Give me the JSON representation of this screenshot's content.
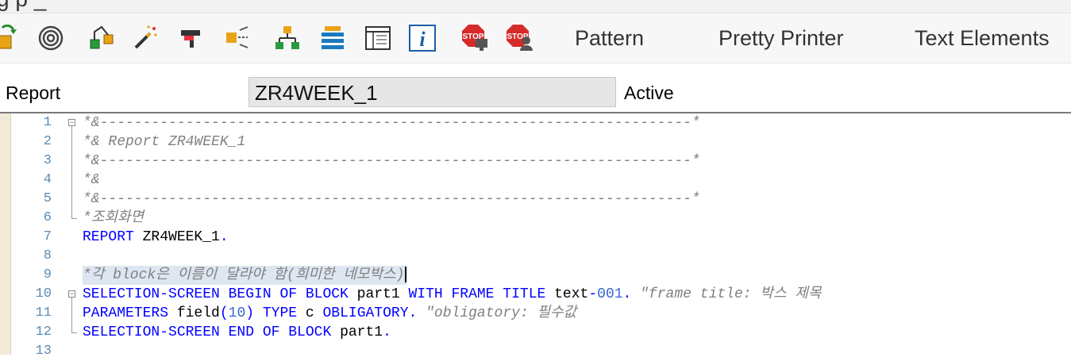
{
  "title_fragment": "g          p               _",
  "toolbar": {
    "icons": [
      {
        "name": "other-object-icon"
      },
      {
        "name": "check-icon"
      },
      {
        "name": "activate-icon"
      },
      {
        "name": "test-wand-icon"
      },
      {
        "name": "where-used-icon"
      },
      {
        "name": "navigation-icon"
      },
      {
        "name": "object-list-icon"
      },
      {
        "name": "display-object-list-icon"
      },
      {
        "name": "dictionary-icon"
      },
      {
        "name": "info-icon"
      },
      {
        "name": "set-breakpoint-icon"
      },
      {
        "name": "set-session-breakpoint-icon"
      }
    ],
    "pattern_label": "Pattern",
    "pretty_printer_label": "Pretty Printer",
    "text_elements_label": "Text Elements"
  },
  "header": {
    "object_type_label": "Report",
    "program_name": "ZR4WEEK_1",
    "status": "Active"
  },
  "editor": {
    "lines": [
      {
        "num": "1",
        "parts": [
          {
            "t": "*&---------------------------------------------------------------------*",
            "c": "cmt"
          }
        ]
      },
      {
        "num": "2",
        "parts": [
          {
            "t": "*& Report ZR4WEEK_1",
            "c": "cmt"
          }
        ]
      },
      {
        "num": "3",
        "parts": [
          {
            "t": "*&---------------------------------------------------------------------*",
            "c": "cmt"
          }
        ]
      },
      {
        "num": "4",
        "parts": [
          {
            "t": "*&",
            "c": "cmt"
          }
        ]
      },
      {
        "num": "5",
        "parts": [
          {
            "t": "*&---------------------------------------------------------------------*",
            "c": "cmt"
          }
        ]
      },
      {
        "num": "6",
        "parts": [
          {
            "t": "*조회화면",
            "c": "cmt"
          }
        ]
      },
      {
        "num": "7",
        "parts": [
          {
            "t": "REPORT ",
            "c": "kw"
          },
          {
            "t": "ZR4WEEK_1",
            "c": "id"
          },
          {
            "t": ".",
            "c": "kw"
          }
        ]
      },
      {
        "num": "8",
        "parts": []
      },
      {
        "num": "9",
        "parts": [
          {
            "t": "*각 block은 이름이 달라야 함(희미한 네모박스)",
            "c": "cmt"
          }
        ]
      },
      {
        "num": "10",
        "parts": [
          {
            "t": "SELECTION-SCREEN BEGIN OF BLOCK ",
            "c": "kw"
          },
          {
            "t": "part1 ",
            "c": "id"
          },
          {
            "t": "WITH FRAME TITLE ",
            "c": "kw"
          },
          {
            "t": "text",
            "c": "id"
          },
          {
            "t": "-",
            "c": "kw"
          },
          {
            "t": "001",
            "c": "num"
          },
          {
            "t": ". ",
            "c": "kw"
          },
          {
            "t": "\"frame title: 박스 제목",
            "c": "cmt"
          }
        ]
      },
      {
        "num": "11",
        "parts": [
          {
            "t": "PARAMETERS ",
            "c": "kw"
          },
          {
            "t": "field",
            "c": "id"
          },
          {
            "t": "(",
            "c": "kw"
          },
          {
            "t": "10",
            "c": "num"
          },
          {
            "t": ") ",
            "c": "kw"
          },
          {
            "t": "TYPE ",
            "c": "kw"
          },
          {
            "t": "c ",
            "c": "id"
          },
          {
            "t": "OBLIGATORY. ",
            "c": "kw"
          },
          {
            "t": "\"obligatory: 필수값",
            "c": "cmt"
          }
        ]
      },
      {
        "num": "12",
        "parts": [
          {
            "t": "SELECTION-SCREEN END OF BLOCK ",
            "c": "kw"
          },
          {
            "t": "part1",
            "c": "id"
          },
          {
            "t": ".",
            "c": "kw"
          }
        ]
      },
      {
        "num": "13",
        "parts": []
      }
    ]
  }
}
